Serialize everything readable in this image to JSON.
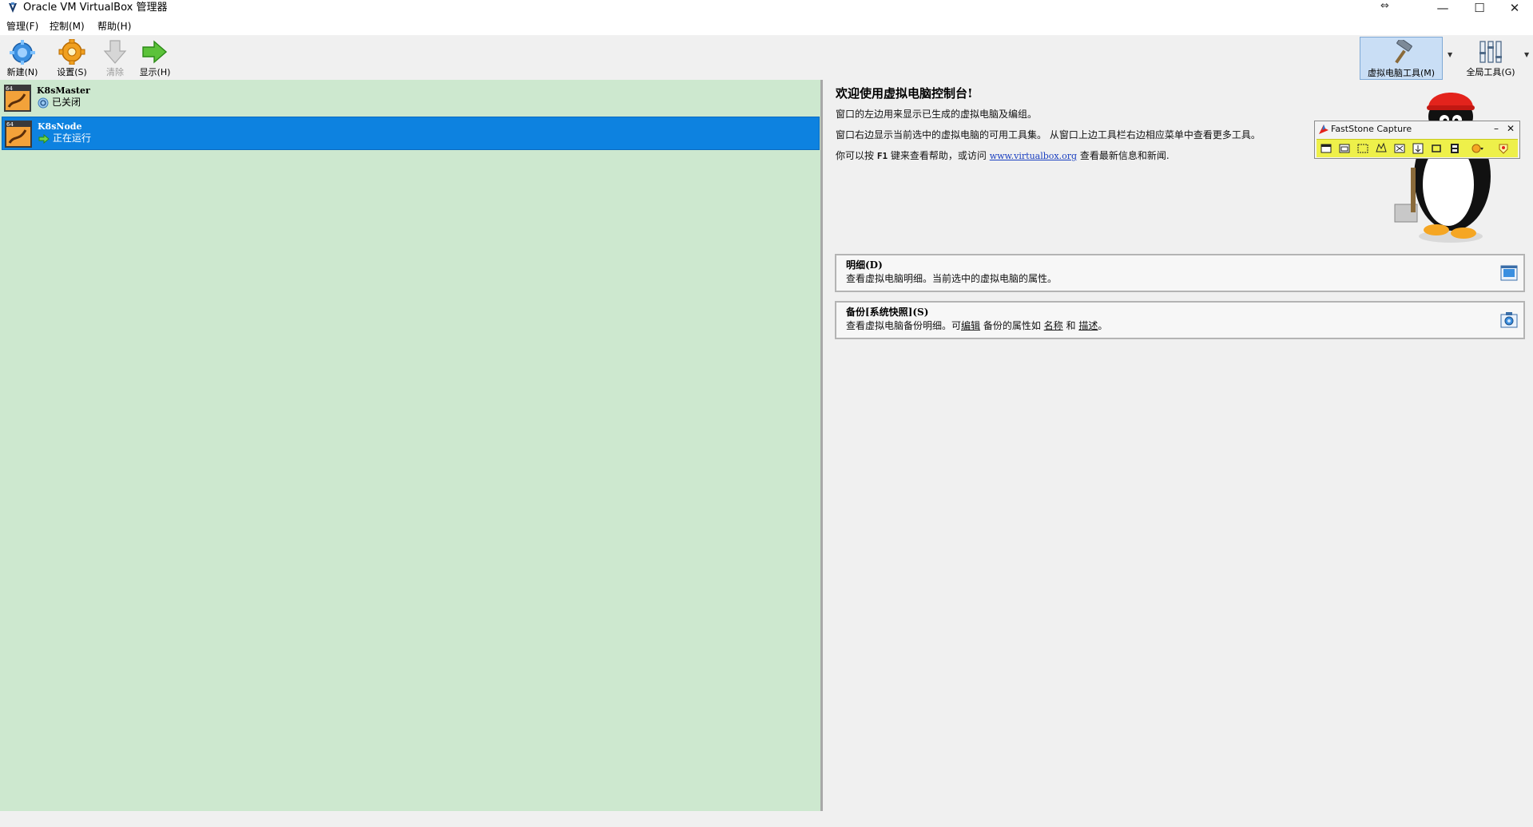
{
  "window": {
    "title": "Oracle VM VirtualBox 管理器",
    "minimize": "—",
    "maximize": "☐",
    "close": "✕",
    "resize_glyph": "⇔"
  },
  "menu": {
    "items": [
      "管理(F)",
      "控制(M)",
      "帮助(H)"
    ]
  },
  "toolbar": {
    "new_label": "新建(N)",
    "settings_label": "设置(S)",
    "discard_label": "清除",
    "show_label": "显示(H)",
    "machine_tools_label": "虚拟电脑工具(M)",
    "global_tools_label": "全局工具(G)"
  },
  "vms": [
    {
      "name": "K8sMaster",
      "state": "已关闭",
      "state_icon": "power-off-icon",
      "selected": false
    },
    {
      "name": "K8sNode",
      "state": "正在运行",
      "state_icon": "running-arrow-icon",
      "selected": true
    }
  ],
  "welcome": {
    "title": "欢迎使用虚拟电脑控制台!",
    "line1": "窗口的左边用来显示已生成的虚拟电脑及编组。",
    "line2": "窗口右边显示当前选中的虚拟电脑的可用工具集。 从窗口上边工具栏右边相应菜单中查看更多工具。",
    "line3_pre": "你可以按 ",
    "line3_key": "F1",
    "line3_mid": " 键来查看帮助，或访问 ",
    "line3_link": "www.virtualbox.org",
    "line3_post": " 查看最新信息和新闻."
  },
  "tool_cards": [
    {
      "title": "明细(D)",
      "desc": "查看虚拟电脑明细。当前选中的虚拟电脑的属性。",
      "icon": "details-icon"
    },
    {
      "title": "备份[系统快照](S)",
      "desc_pre": "查看虚拟电脑备份明细。可",
      "desc_u1": "编辑",
      "desc_mid1": " 备份的属性如 ",
      "desc_u2": "名称",
      "desc_mid2": " 和 ",
      "desc_u3": "描述",
      "desc_post": "。",
      "icon": "snapshots-icon"
    }
  ],
  "faststone": {
    "title": "FastStone Capture",
    "minimize": "–",
    "close": "✕",
    "buttons": [
      "capture-window-icon",
      "capture-object-icon",
      "capture-rect-icon",
      "capture-freehand-icon",
      "capture-fullscreen-icon",
      "capture-scrolling-icon",
      "capture-fixed-region-icon",
      "capture-video-icon",
      "output-options-icon",
      "settings-icon"
    ],
    "bar_color": "#eef04a"
  },
  "colors": {
    "vm_list_bg": "#cde8cf",
    "selection": "#0d82e0"
  }
}
